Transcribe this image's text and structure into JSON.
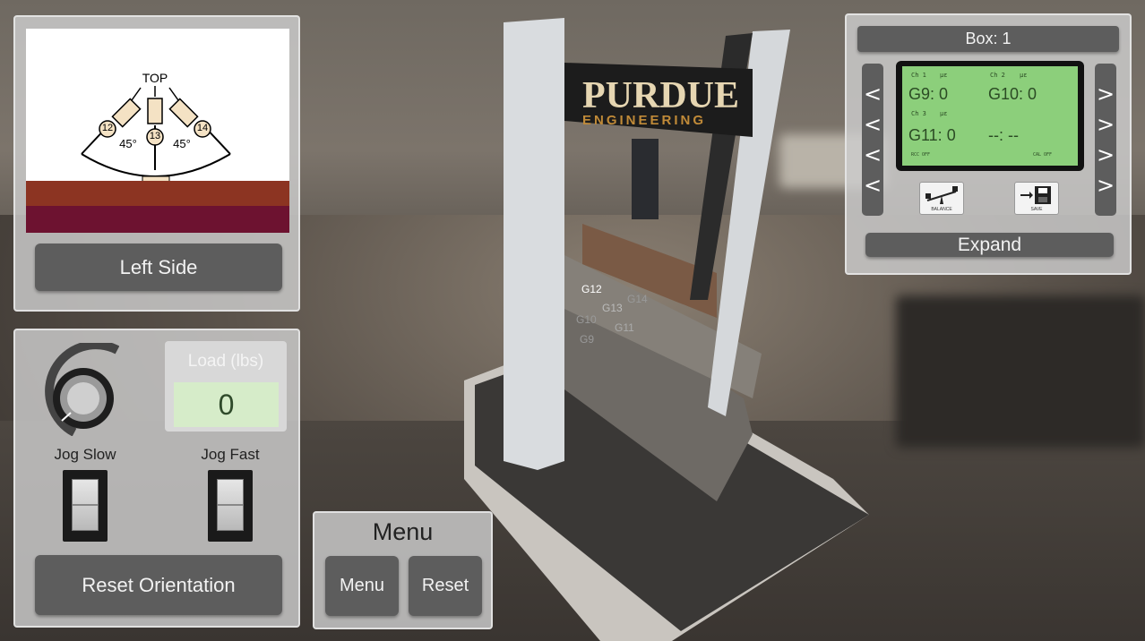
{
  "left_panel": {
    "diagram": {
      "top_label": "TOP",
      "gauges": [
        "12",
        "13",
        "14"
      ],
      "angle_left": "45°",
      "angle_right": "45°"
    },
    "side_button": "Left Side"
  },
  "control_panel": {
    "load_label": "Load (lbs)",
    "load_value": "0",
    "jog_slow": "Jog Slow",
    "jog_fast": "Jog Fast",
    "reset_orientation": "Reset Orientation"
  },
  "menu_panel": {
    "title": "Menu",
    "menu_button": "Menu",
    "reset_button": "Reset"
  },
  "box_panel": {
    "title": "Box: 1",
    "lcd": {
      "ch1": "Ch 1",
      "ch1_unit": "µε",
      "ch2": "Ch 2",
      "ch2_unit": "µε",
      "ch3": "Ch 3",
      "ch3_unit": "µε",
      "g9": "G9: 0",
      "g10": "G10: 0",
      "g11": "G11: 0",
      "ch4": "--: --",
      "rcc": "RCC OFF",
      "cal": "CAL OFF"
    },
    "left_arrows": [
      "<",
      "<",
      "<",
      "<"
    ],
    "right_arrows": [
      ">",
      ">",
      ">",
      ">"
    ],
    "balance_label": "BALANCE",
    "save_label": "SAVE",
    "expand_button": "Expand"
  },
  "scene": {
    "sign_main": "PURDUE",
    "sign_sub": "ENGINEERING",
    "gauge_tags": [
      "G12",
      "G13",
      "G14",
      "G10",
      "G11",
      "G9"
    ]
  },
  "colors": {
    "panel": "#cdcdcd",
    "button": "#5d5d5d",
    "lcd_green": "#8ccf7b",
    "load_green": "#d6ecc9"
  }
}
